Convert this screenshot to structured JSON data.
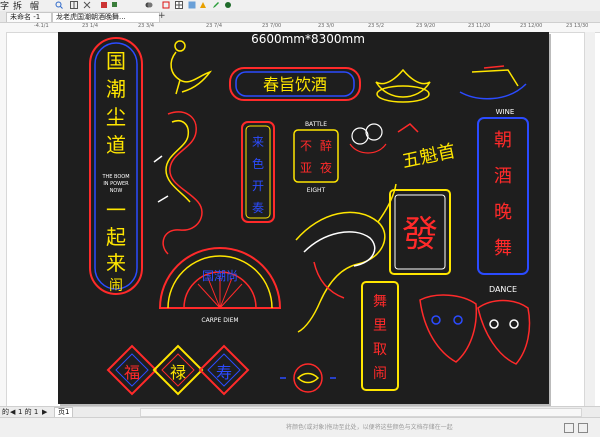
{
  "toolbar": {
    "items": [
      "字",
      "拆",
      "帽"
    ]
  },
  "tabs": {
    "tab1": "未命名 -1",
    "tab2": "龙老虎国潮朝酒晚舞...",
    "add": "+"
  },
  "ruler": {
    "labels": [
      "-4.1/1",
      "23 1/4",
      "23 3/4",
      "23 7/4",
      "23 7/00",
      "23 3/0",
      "23 5/2",
      "23 9/20",
      "23 11/20",
      "23 12/00",
      "23 13/30"
    ]
  },
  "canvas": {
    "size_label": "6600mm*8300mm",
    "left_column_chars": [
      "国",
      "潮",
      "尘",
      "道",
      "一",
      "起",
      "来",
      "闹"
    ],
    "left_column_en": [
      "THE BOOM",
      "IN POWER",
      "NOW"
    ],
    "title_sign": "春旨饮酒",
    "battle_label": "BATTLE",
    "battle_chars": [
      "不",
      "醉",
      "亚",
      "夜"
    ],
    "eight_label": "EIGHT",
    "side_sign": "五魁首",
    "vertical_chars": [
      "来",
      "色",
      "开",
      "奏"
    ],
    "fa_char": "發",
    "wine_label": "WINE",
    "right_column_chars": [
      "朝",
      "酒",
      "晚",
      "舞"
    ],
    "dance_label": "DANCE",
    "fan_chars": "国潮尚",
    "carpe_label": "CARPE DIEM",
    "bottom_tiles": [
      "福",
      "禄",
      "寿"
    ],
    "bottom_vertical": [
      "舞",
      "里",
      "取",
      "闹"
    ]
  },
  "bottom_bar": {
    "page_prefix": "的",
    "page_of": "1 的 1",
    "page_tab": "页1"
  },
  "status": {
    "hint": "将颜色(或对象)拖动至此处，以便将这些颜色与文档存储在一起"
  },
  "colors": {
    "canvas_bg": "#1e1e1e",
    "neon_red": "#ff2a2a",
    "neon_yellow": "#ffe600",
    "neon_blue": "#2b4bff",
    "neon_white": "#ffffff"
  }
}
